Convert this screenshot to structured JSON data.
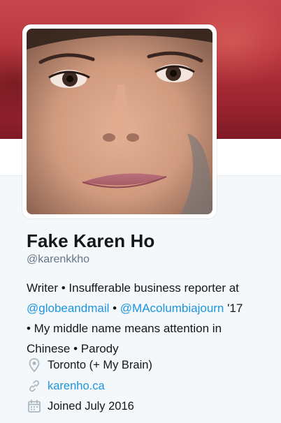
{
  "profile": {
    "display_name": "Fake Karen Ho",
    "handle": "@karenkkho",
    "bio": {
      "line1": "Writer • Insufferable business reporter at",
      "mention1": "@globeandmail",
      "sep": " • ",
      "mention2": "@MAcolumbiajourn",
      "line2_tail": " '17",
      "line3": "• My middle name means attention in",
      "line4": "Chinese • Parody"
    },
    "location": "Toronto (+ My Brain)",
    "website": "karenho.ca",
    "joined": "Joined July 2016"
  },
  "icons": {
    "location": "map-pin-icon",
    "website": "link-icon",
    "joined": "calendar-icon"
  },
  "colors": {
    "link": "#1b95e0",
    "text": "#14171a",
    "muted": "#657786",
    "header": "#b6343c",
    "icon": "#aab8c2"
  }
}
